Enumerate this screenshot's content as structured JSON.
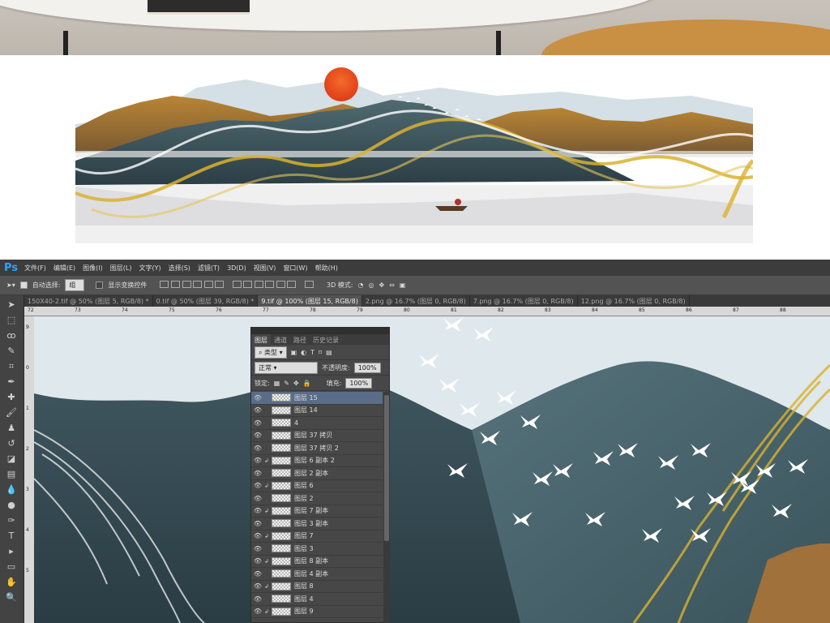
{
  "app": {
    "logo": "Ps"
  },
  "menus": [
    "文件(F)",
    "编辑(E)",
    "图像(I)",
    "图层(L)",
    "文字(Y)",
    "选择(S)",
    "滤镜(T)",
    "3D(D)",
    "视图(V)",
    "窗口(W)",
    "帮助(H)"
  ],
  "options": {
    "auto_select_label": "自动选择:",
    "auto_select_checked": true,
    "auto_select_value": "组",
    "show_transform_label": "显示变换控件",
    "show_transform_checked": false,
    "mode_3d_label": "3D 模式:"
  },
  "tabs": [
    {
      "label": "150X40-2.tif @ 50% (图层 5, RGB/8) *",
      "active": false
    },
    {
      "label": "0.tif @ 50% (图层 39, RGB/8) *",
      "active": false
    },
    {
      "label": "9.tif @ 100% (图层 15, RGB/8)",
      "active": true
    },
    {
      "label": "2.png @ 16.7% (图层 0, RGB/8)",
      "active": false
    },
    {
      "label": "7.png @ 16.7% (图层 0, RGB/8)",
      "active": false
    },
    {
      "label": "12.png @ 16.7% (图层 0, RGB/8)",
      "active": false
    }
  ],
  "ruler_h": [
    "72",
    "73",
    "74",
    "75",
    "76",
    "77",
    "78",
    "79",
    "80",
    "81",
    "82",
    "83",
    "84",
    "85",
    "86",
    "87",
    "88"
  ],
  "ruler_v": [
    "9",
    "0",
    "1",
    "2",
    "3",
    "4",
    "5"
  ],
  "layers_panel": {
    "tabs": [
      "图层",
      "通道",
      "路径",
      "历史记录"
    ],
    "active_tab": "图层",
    "filter_label": "类型",
    "blend_mode": "正常",
    "opacity_label": "不透明度:",
    "opacity_value": "100%",
    "lock_label": "锁定:",
    "fill_label": "填充:",
    "fill_value": "100%",
    "layers": [
      {
        "name": "图层 15",
        "selected": true,
        "clipped": false
      },
      {
        "name": "图层 14",
        "selected": false,
        "clipped": false
      },
      {
        "name": "4",
        "selected": false,
        "clipped": false
      },
      {
        "name": "图层 37 拷贝",
        "selected": false,
        "clipped": false
      },
      {
        "name": "图层 37 拷贝 2",
        "selected": false,
        "clipped": false
      },
      {
        "name": "图层 6 副本 2",
        "selected": false,
        "clipped": true
      },
      {
        "name": "图层 2 副本",
        "selected": false,
        "clipped": false
      },
      {
        "name": "图层 6",
        "selected": false,
        "clipped": true
      },
      {
        "name": "图层 2",
        "selected": false,
        "clipped": false
      },
      {
        "name": "图层 7 副本",
        "selected": false,
        "clipped": true
      },
      {
        "name": "图层 3 副本",
        "selected": false,
        "clipped": false
      },
      {
        "name": "图层 7",
        "selected": false,
        "clipped": true
      },
      {
        "name": "图层 3",
        "selected": false,
        "clipped": false
      },
      {
        "name": "图层 8 副本",
        "selected": false,
        "clipped": true
      },
      {
        "name": "图层 4 副本",
        "selected": false,
        "clipped": false
      },
      {
        "name": "图层 8",
        "selected": false,
        "clipped": true
      },
      {
        "name": "图层 4",
        "selected": false,
        "clipped": false
      },
      {
        "name": "图层 9",
        "selected": false,
        "clipped": true
      }
    ]
  },
  "colors": {
    "ps_blue": "#2fa3f5",
    "mountain_teal": "#3b5258",
    "gold": "#c89a4a",
    "sun": "#e8501f",
    "ribbon": "#d9b230"
  },
  "icons": {
    "tools": [
      "move-tool",
      "marquee-tool",
      "lasso-tool",
      "quick-select-tool",
      "crop-tool",
      "eyedropper-tool",
      "healing-tool",
      "brush-tool",
      "stamp-tool",
      "history-brush-tool",
      "eraser-tool",
      "gradient-tool",
      "blur-tool",
      "dodge-tool",
      "pen-tool",
      "type-tool",
      "path-select-tool",
      "shape-tool",
      "hand-tool",
      "zoom-tool"
    ]
  }
}
